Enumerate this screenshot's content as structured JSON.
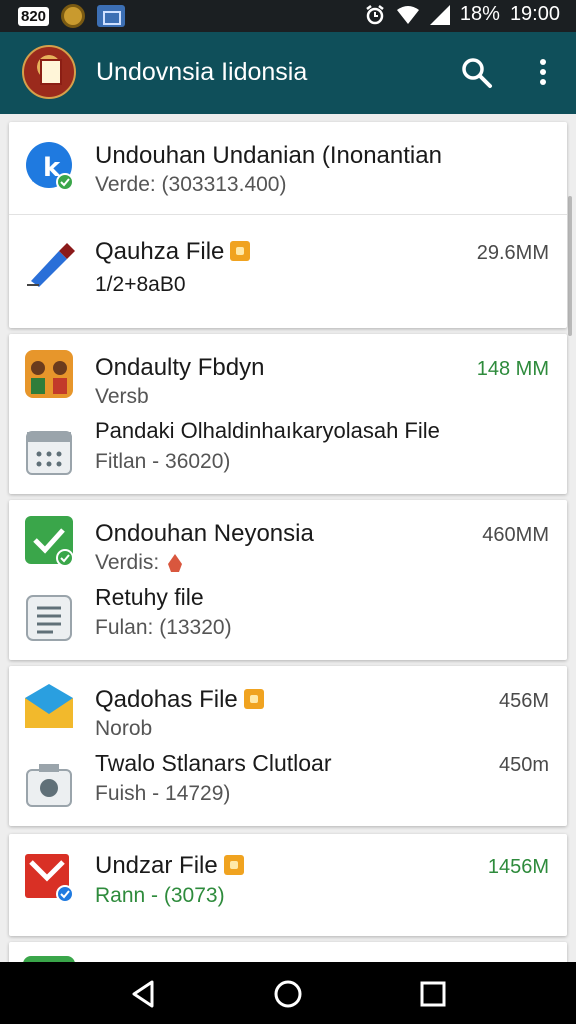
{
  "status_bar": {
    "tag": "820",
    "battery": "18%",
    "time": "19:00"
  },
  "app_bar": {
    "title": "Undovnsia Iidonsia"
  },
  "items": [
    {
      "title": "Undouhan Undanian (Inonantian",
      "subtitle": "Verde: (303313.400)"
    },
    {
      "title": "Qauhza File",
      "subtitle": "1/2+8aB0",
      "size": "29.6MM"
    },
    {
      "title": "Ondaulty Fbdyn",
      "subtitle": "Versb",
      "size": "148 MM"
    },
    {
      "title": "Pandaki Olhaldinhaıkaryolasah File",
      "subtitle": "Fitlan - 36020)"
    },
    {
      "title": "Ondouhan Neyonsia",
      "subtitle": "Verdis:",
      "size": "460MM"
    },
    {
      "title": "Retuhy file",
      "subtitle": "Fulan: (13320)"
    },
    {
      "title": "Qadohas File",
      "subtitle": "Norob",
      "size": "456M"
    },
    {
      "title": "Twalo Stlanars Clutloar",
      "subtitle": "Fuish - 14729)",
      "size": "450m"
    },
    {
      "title": "Undzar File",
      "subtitle": "Rann - (3073)",
      "size": "1456M"
    }
  ],
  "colors": {
    "app_bar": "#0f4f5a",
    "status_bar": "#1b1f22",
    "size_green": "#2e8b3c",
    "lock_badge": "#f0a320"
  }
}
